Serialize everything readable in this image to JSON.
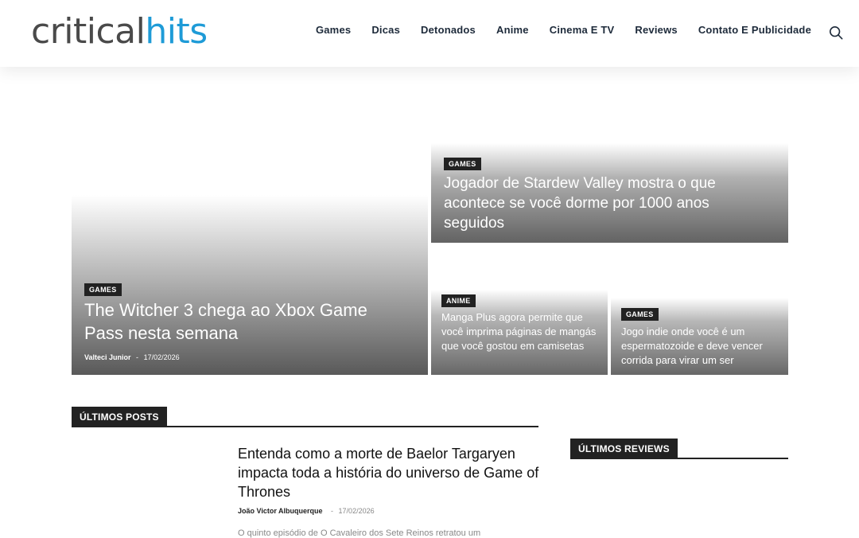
{
  "header": {
    "logo_part1": "critical",
    "logo_part2": "hits",
    "nav": [
      "Games",
      "Dicas",
      "Detonados",
      "Anime",
      "Cinema E TV",
      "Reviews",
      "Contato E Publicidade"
    ]
  },
  "featured": {
    "main": {
      "category": "GAMES",
      "title": "The Witcher 3 chega ao Xbox Game Pass nesta semana",
      "author": "Valteci Junior",
      "separator": "-",
      "date": "17/02/2026"
    },
    "top_right": {
      "category": "GAMES",
      "title": "Jogador de Stardew Valley mostra o que acontece se você dorme por 1000 anos seguidos"
    },
    "bottom_left": {
      "category": "ANIME",
      "title": "Manga Plus agora permite que você imprima páginas de mangás que você gostou em camisetas"
    },
    "bottom_right": {
      "category": "GAMES",
      "title": "Jogo indie onde você é um espermatozoide e deve vencer corrida para virar um ser"
    }
  },
  "latest": {
    "heading": "ÚLTIMOS POSTS",
    "post": {
      "title": "Entenda como a morte de Baelor Targaryen impacta toda a história do universo de Game of Thrones",
      "author": "João Victor Albuquerque",
      "separator": "-",
      "date": "17/02/2026",
      "excerpt": "O quinto episódio de O Cavaleiro dos Sete Reinos retratou um"
    }
  },
  "reviews": {
    "heading": "ÚLTIMOS REVIEWS"
  }
}
